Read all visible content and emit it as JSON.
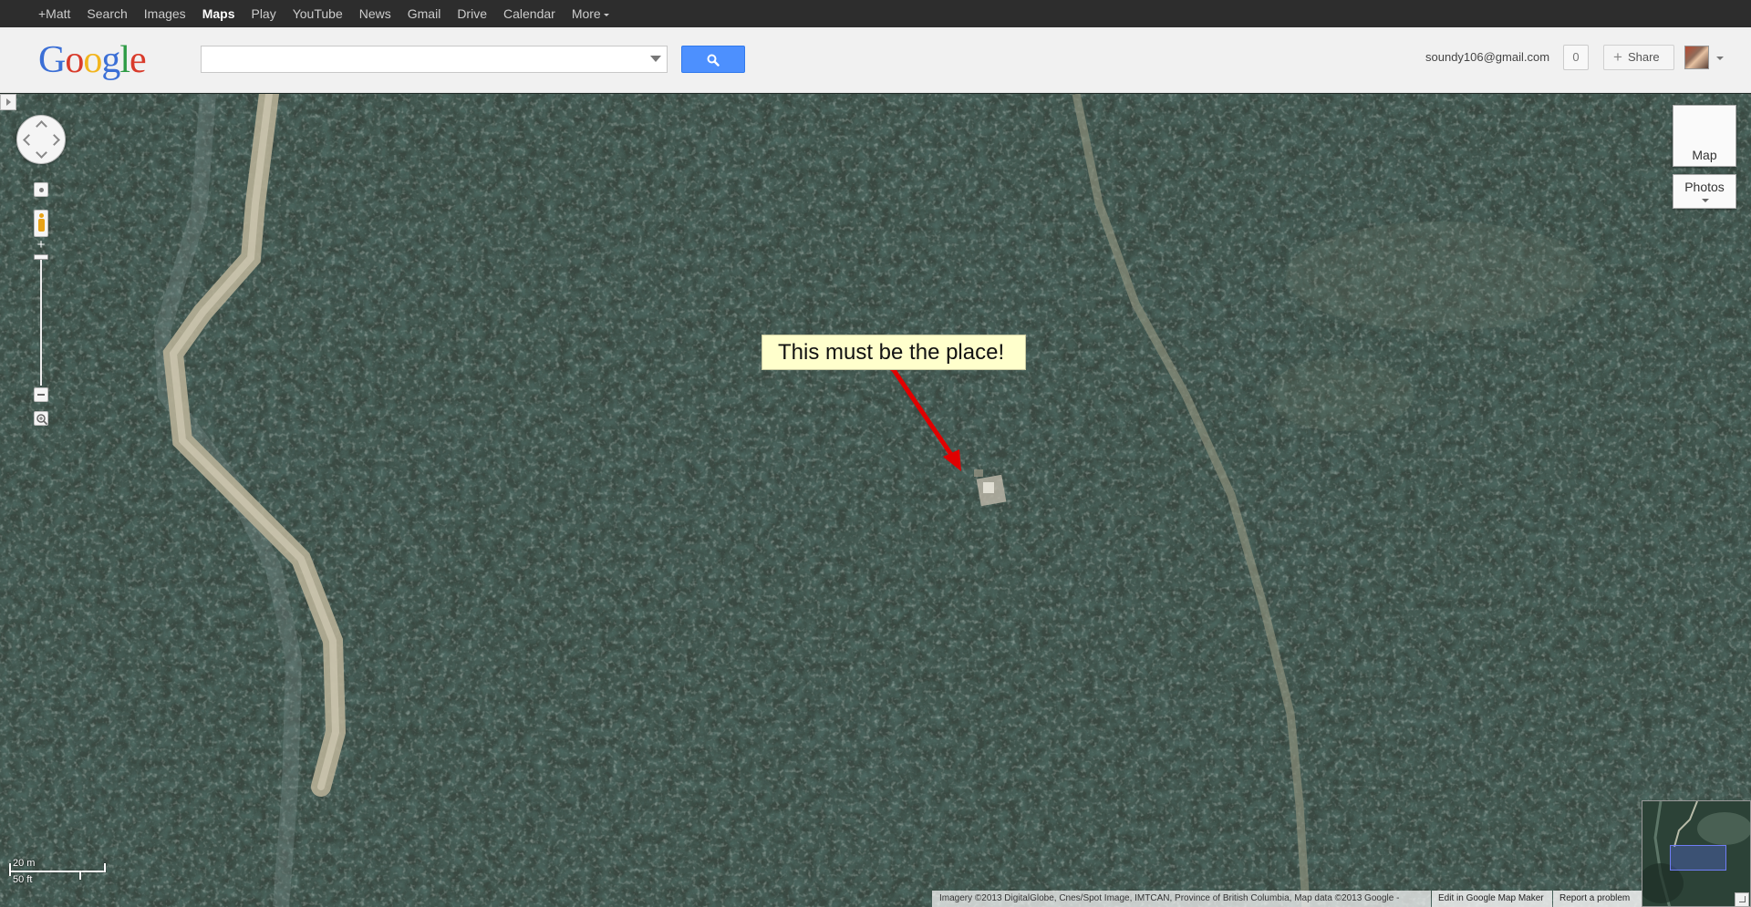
{
  "topnav": {
    "items": [
      {
        "label": "+Matt",
        "active": false
      },
      {
        "label": "Search",
        "active": false
      },
      {
        "label": "Images",
        "active": false
      },
      {
        "label": "Maps",
        "active": true
      },
      {
        "label": "Play",
        "active": false
      },
      {
        "label": "YouTube",
        "active": false
      },
      {
        "label": "News",
        "active": false
      },
      {
        "label": "Gmail",
        "active": false
      },
      {
        "label": "Drive",
        "active": false
      },
      {
        "label": "Calendar",
        "active": false
      }
    ],
    "more_label": "More"
  },
  "header": {
    "logo": {
      "g1": "G",
      "o1": "o",
      "o2": "o",
      "g2": "g",
      "l": "l",
      "e": "e"
    },
    "search": {
      "value": "",
      "placeholder": ""
    },
    "account_email": "soundy106@gmail.com",
    "notification_count": "0",
    "share_label": "Share"
  },
  "map": {
    "maptype_map_label": "Map",
    "maptype_photos_label": "Photos",
    "callout_text": "This must be the place!",
    "scale_metric": "20 m",
    "scale_imperial": "50 ft",
    "attribution": "Imagery ©2013 DigitalGlobe, Cnes/Spot Image, IMTCAN, Province of British Columbia, Map data ©2013 Google -",
    "edit_link": "Edit in Google Map Maker",
    "report_link": "Report a problem"
  },
  "colors": {
    "topbar": "#2d2d2d",
    "header": "#f1f1f1",
    "search_button": "#4d90fe",
    "callout_bg": "#ffffcc",
    "callout_arrow": "#e00000",
    "forest": "#26342d",
    "road": "#b9b39b"
  },
  "icons": {
    "search_button": "magnifier-icon",
    "zoom_magnify": "zoom-area-icon",
    "pegman": "pegman-icon",
    "share": "plus-icon"
  }
}
